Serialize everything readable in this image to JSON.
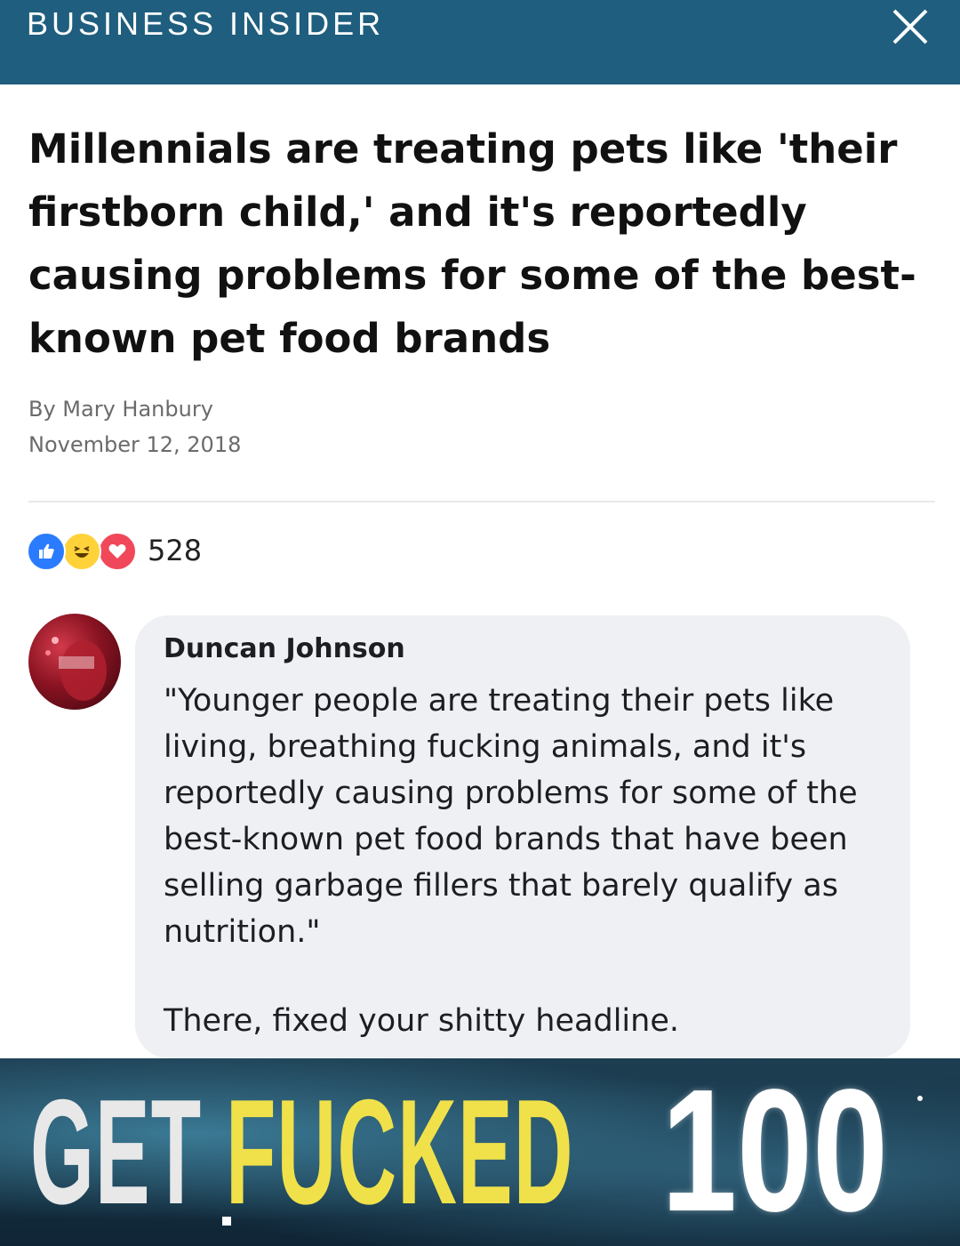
{
  "header": {
    "brand": "BUSINESS INSIDER",
    "close_icon": "close-icon",
    "background_color": "#1f5e7e"
  },
  "article": {
    "headline": "Millennials are treating pets like 'their firstborn child,' and it's reportedly causing problems for some of the best-known pet food brands",
    "author": "By Mary Hanbury",
    "date": "November 12, 2018"
  },
  "reactions": {
    "icons": [
      "like-icon",
      "haha-icon",
      "love-icon"
    ],
    "count": "528"
  },
  "comment": {
    "author": "Duncan Johnson",
    "body": "\"Younger people are treating their pets like living, breathing fucking animals, and it's reportedly causing problems for some of the best-known pet food brands that have been selling garbage fillers that barely qualify as nutrition.\"",
    "fix": "There, fixed your shitty headline."
  },
  "meme": {
    "word1": "GET",
    "word2": "FUCKED",
    "score": "100"
  }
}
